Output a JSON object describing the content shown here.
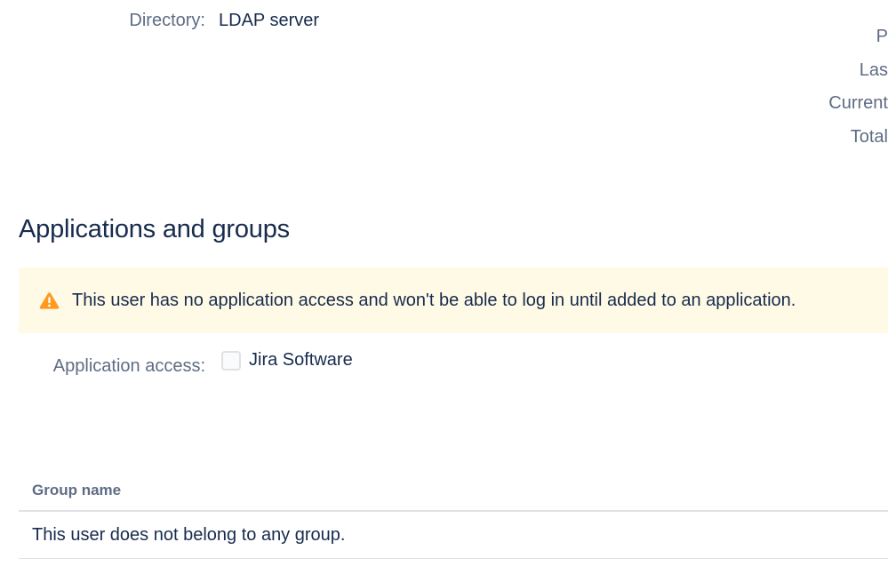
{
  "profile": {
    "directory_label": "Directory:",
    "directory_value": "LDAP server",
    "right_labels": [
      "P",
      "Las",
      "Current",
      "Total"
    ]
  },
  "applications": {
    "heading": "Applications and groups",
    "warning": {
      "icon": "warning-triangle-icon",
      "text": "This user has no application access and won't be able to log in until added to an application.",
      "color": "#ff991f",
      "background": "#fffae6"
    },
    "access_label": "Application access:",
    "app_name": "Jira Software",
    "app_checked": false
  },
  "groups": {
    "column_header": "Group name",
    "empty_message": "This user does not belong to any group."
  }
}
